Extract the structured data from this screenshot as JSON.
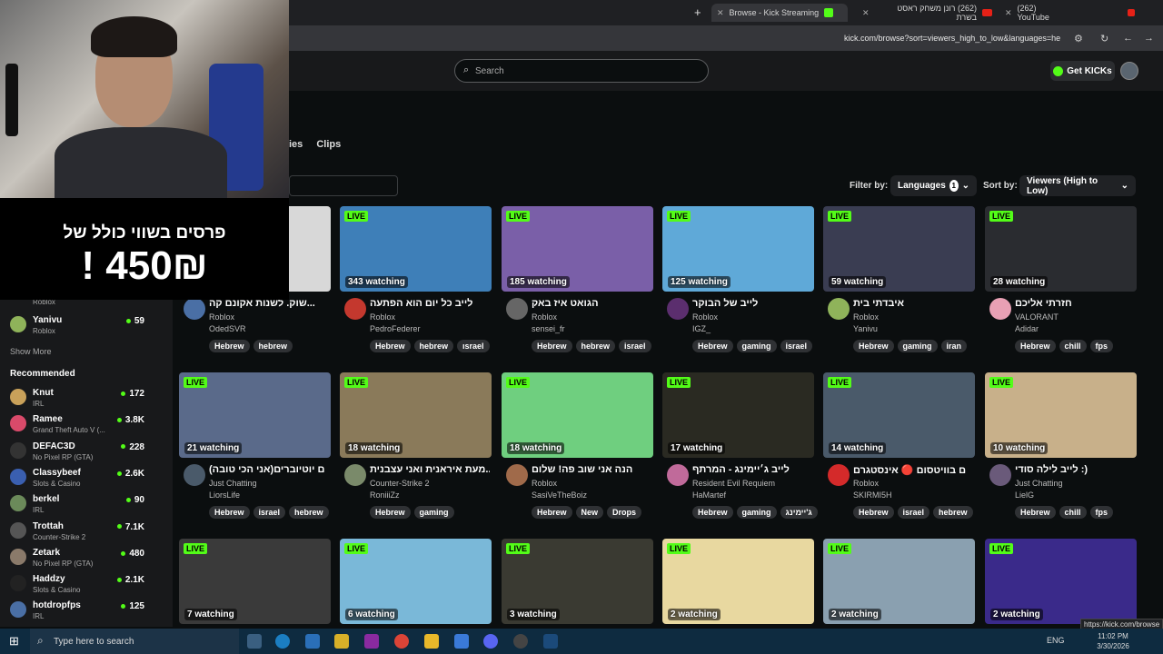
{
  "browser": {
    "new_tab_symbol": "+",
    "tabs": [
      {
        "title": "Browse - Kick Streaming",
        "active": true
      },
      {
        "title": "(262) רונן משחק ראסט בשרת",
        "active": false
      },
      {
        "title": "(262) YouTube",
        "active": false
      }
    ],
    "url": "kick.com/browse?sort=viewers_high_to_low&languages=he",
    "status_url": "https://kick.com/browse"
  },
  "header": {
    "search_placeholder": "Search",
    "get_kicks_label": "Get KICKs"
  },
  "browse_tabs": [
    "ies",
    "Clips"
  ],
  "filters": {
    "filter_by_label": "Filter by:",
    "languages_label": "Languages",
    "languages_count": "1",
    "sort_by_label": "Sort by:",
    "sort_value": "Viewers (High to Low)"
  },
  "overlay": {
    "line1": "פרסים בשווי כולל של",
    "line2": "450₪ !"
  },
  "sidebar": {
    "following": [
      {
        "name": "",
        "category": "Roblox",
        "count": "",
        "color": "#7b5ea8"
      },
      {
        "name": "Yanivu",
        "category": "Roblox",
        "count": "59",
        "color": "#8fb35a"
      }
    ],
    "show_more": "Show More",
    "recommended_title": "Recommended",
    "recommended": [
      {
        "name": "Knut",
        "category": "IRL",
        "count": "172",
        "color": "#c9a15a"
      },
      {
        "name": "Ramee",
        "category": "Grand Theft Auto V (...",
        "count": "3.8K",
        "color": "#d94a6a"
      },
      {
        "name": "DEFAC3D",
        "category": "No Pixel RP (GTA)",
        "count": "228",
        "color": "#333"
      },
      {
        "name": "Classybeef",
        "category": "Slots & Casino",
        "count": "2.6K",
        "color": "#3a5fb0"
      },
      {
        "name": "berkel",
        "category": "IRL",
        "count": "90",
        "color": "#6b8a5a"
      },
      {
        "name": "Trottah",
        "category": "Counter-Strike 2",
        "count": "7.1K",
        "color": "#555"
      },
      {
        "name": "Zetark",
        "category": "No Pixel RP (GTA)",
        "count": "480",
        "color": "#8a7a6a"
      },
      {
        "name": "Haddzy",
        "category": "Slots & Casino",
        "count": "2.1K",
        "color": "#222"
      },
      {
        "name": "hotdropfps",
        "category": "IRL",
        "count": "125",
        "color": "#4a6fa5"
      }
    ]
  },
  "streams": [
    {
      "title": "שוק. לשנות אקונם קה...",
      "category": "Roblox",
      "user": "OdedSVR",
      "watching": "",
      "tags": [
        "Hebrew",
        "hebrew"
      ],
      "live": false,
      "thumb": "#d8d8d8",
      "avatar": "#4a6fa5"
    },
    {
      "title": "לייב כל יום הוא הפתעה",
      "category": "Roblox",
      "user": "PedroFederer",
      "watching": "343 watching",
      "tags": [
        "Hebrew",
        "hebrew",
        "ısrael"
      ],
      "live": true,
      "thumb": "#3e7fb8",
      "avatar": "#c4382e"
    },
    {
      "title": "הגואט איז באק",
      "category": "Roblox",
      "user": "sensei_fr",
      "watching": "185 watching",
      "tags": [
        "Hebrew",
        "hebrew",
        "israel"
      ],
      "live": true,
      "thumb": "#7a5fa8",
      "avatar": "#666"
    },
    {
      "title": "לייב של הבוקר",
      "category": "Roblox",
      "user": "IGZ_",
      "watching": "125 watching",
      "tags": [
        "Hebrew",
        "gaming",
        "israel"
      ],
      "live": true,
      "thumb": "#5fa9d8",
      "avatar": "#5b2e6e"
    },
    {
      "title": "איבדתי בית",
      "category": "Roblox",
      "user": "Yanivu",
      "watching": "59 watching",
      "tags": [
        "Hebrew",
        "gaming",
        "iran"
      ],
      "live": true,
      "thumb": "#3a3d52",
      "avatar": "#8fb35a"
    },
    {
      "title": "חזרתי אליכם",
      "category": "VALORANT",
      "user": "Adidar",
      "watching": "28 watching",
      "tags": [
        "Hebrew",
        "chill",
        "fps"
      ],
      "live": true,
      "thumb": "#2a2c30",
      "avatar": "#e8a0b4"
    },
    {
      "title": "ם יוטיוברים(אני הכי טובה)",
      "category": "Just Chatting",
      "user": "LiorsLife",
      "watching": "21 watching",
      "tags": [
        "Hebrew",
        "israel",
        "hebrew"
      ],
      "live": true,
      "thumb": "#5a6a8a",
      "avatar": "#4a5a6a"
    },
    {
      "title": "מעת איראנית ואני עצבנית...",
      "category": "Counter-Strike 2",
      "user": "RoniiiZz",
      "watching": "18 watching",
      "tags": [
        "Hebrew",
        "gaming"
      ],
      "live": true,
      "thumb": "#8a7a5a",
      "avatar": "#7a8a6a"
    },
    {
      "title": "הנה אני שוב פה! שלום",
      "category": "Roblox",
      "user": "SasiVeTheBoiz",
      "watching": "18 watching",
      "tags": [
        "Hebrew",
        "New",
        "Drops"
      ],
      "live": true,
      "thumb": "#6fcf7f",
      "avatar": "#a06a4a"
    },
    {
      "title": "לייב ג׳יימינג - המרתף",
      "category": "Resident Evil Requiem",
      "user": "HaMartef",
      "watching": "17 watching",
      "tags": [
        "Hebrew",
        "gaming",
        "ג'יימינג"
      ],
      "live": true,
      "thumb": "#2a2a22",
      "avatar": "#c06a9a"
    },
    {
      "title": "ם בוויטסום 🔴 אינסטגרם",
      "category": "Roblox",
      "user": "SKIRMI5H",
      "watching": "14 watching",
      "tags": [
        "Hebrew",
        "israel",
        "hebrew"
      ],
      "live": true,
      "thumb": "#4a5a6a",
      "avatar": "#d42a2a"
    },
    {
      "title": "לייב לילה סודי :)",
      "category": "Just Chatting",
      "user": "LielG",
      "watching": "10 watching",
      "tags": [
        "Hebrew",
        "chill",
        "fps"
      ],
      "live": true,
      "thumb": "#c8b08a",
      "avatar": "#6a5a7a"
    },
    {
      "title": "",
      "category": "",
      "user": "",
      "watching": "7 watching",
      "tags": [],
      "live": true,
      "thumb": "#3a3a3a",
      "avatar": "#000"
    },
    {
      "title": "",
      "category": "",
      "user": "",
      "watching": "6 watching",
      "tags": [],
      "live": true,
      "thumb": "#7ab8d8",
      "avatar": "#000"
    },
    {
      "title": "",
      "category": "",
      "user": "",
      "watching": "3 watching",
      "tags": [],
      "live": true,
      "thumb": "#3a3a32",
      "avatar": "#000"
    },
    {
      "title": "",
      "category": "",
      "user": "",
      "watching": "2 watching",
      "tags": [],
      "live": true,
      "thumb": "#e8d8a0",
      "avatar": "#000"
    },
    {
      "title": "",
      "category": "",
      "user": "",
      "watching": "2 watching",
      "tags": [],
      "live": true,
      "thumb": "#8aa0b0",
      "avatar": "#000"
    },
    {
      "title": "",
      "category": "",
      "user": "",
      "watching": "2 watching",
      "tags": [],
      "live": true,
      "thumb": "#3a2a8a",
      "avatar": "#000"
    }
  ],
  "live_label": "LIVE",
  "taskbar": {
    "search_placeholder": "Type here to search",
    "lang": "ENG",
    "time": "11:02 PM",
    "date": "3/30/2026"
  }
}
